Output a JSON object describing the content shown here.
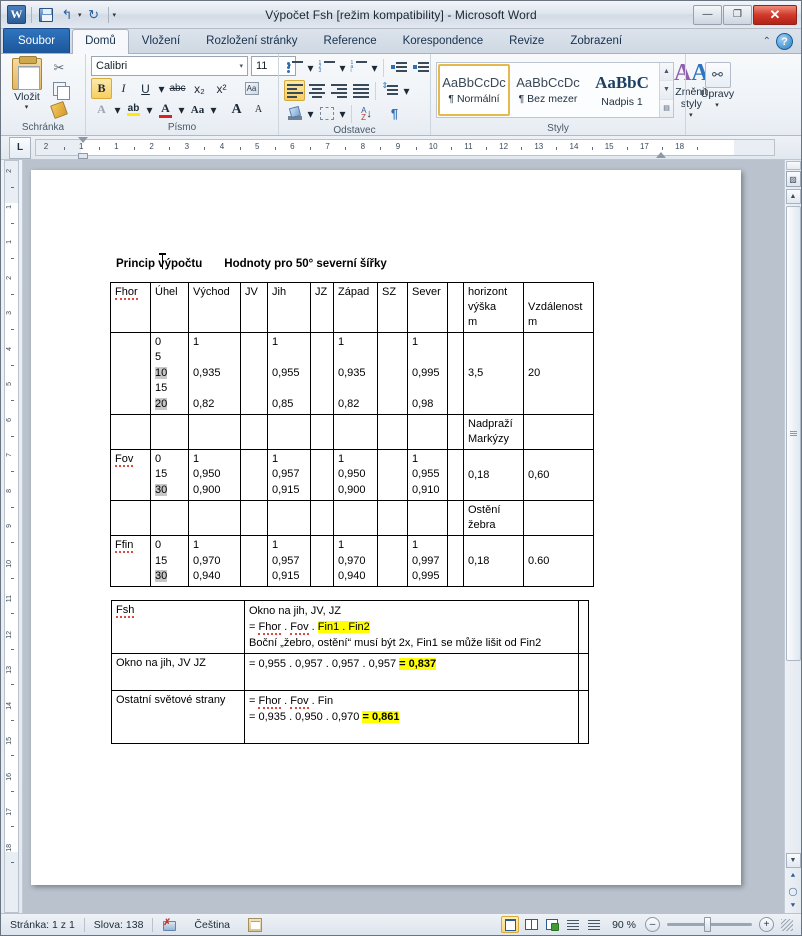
{
  "window": {
    "title": "Výpočet Fsh [režim kompatibility]  -  Microsoft Word",
    "logo": "W",
    "minimize": "—",
    "maximize": "❐",
    "close": "✕"
  },
  "quick_access": {
    "save": "save-icon",
    "undo": "↰",
    "undo_caret": "▾",
    "redo": "↻",
    "customize": "▾"
  },
  "tabs": [
    {
      "label": "Soubor",
      "type": "file"
    },
    {
      "label": "Domů",
      "type": "active"
    },
    {
      "label": "Vložení",
      "type": "normal"
    },
    {
      "label": "Rozložení stránky",
      "type": "normal"
    },
    {
      "label": "Reference",
      "type": "normal"
    },
    {
      "label": "Korespondence",
      "type": "normal"
    },
    {
      "label": "Revize",
      "type": "normal"
    },
    {
      "label": "Zobrazení",
      "type": "normal"
    }
  ],
  "tab_right": {
    "minimize_ribbon": "⌃",
    "help": "?"
  },
  "ribbon": {
    "clipboard": {
      "label": "Schránka",
      "paste": "Vložit",
      "paste_caret": "▾",
      "cut": "✂",
      "copy": "copy-icon",
      "format_painter": "format-painter-icon",
      "launcher": "⌜"
    },
    "font": {
      "label": "Písmo",
      "font_name": "Calibri",
      "font_size": "11",
      "grow": "A",
      "shrink": "A",
      "clear_format": "Aa",
      "bold": "B",
      "italic": "I",
      "underline": "U",
      "strikethrough": "abc",
      "subscript": "x₂",
      "superscript": "x²",
      "change_case": "Aa",
      "text_highlight": "ab",
      "font_color": "A",
      "text_effects": "A",
      "caret": "▾",
      "launcher": "⌜"
    },
    "paragraph": {
      "label": "Odstavec",
      "bullets": "bullets-icon",
      "numbering": "numbering-icon",
      "multilevel": "multilevel-list-icon",
      "decrease_indent": "decrease-indent-icon",
      "increase_indent": "increase-indent-icon",
      "align_left": "align-left-icon",
      "align_center": "align-center-icon",
      "align_right": "align-right-icon",
      "justify": "justify-icon",
      "line_spacing": "line-spacing-icon",
      "shading": "shading-icon",
      "borders": "borders-icon",
      "sort_a": "A",
      "sort_z": "Z",
      "sort_arrow": "↓",
      "show_marks": "¶",
      "caret": "▾",
      "launcher": "⌜"
    },
    "styles": {
      "label": "Styly",
      "items": [
        {
          "preview": "AaBbCcDc",
          "name": "¶ Normální",
          "selected": true
        },
        {
          "preview": "AaBbCcDc",
          "name": "¶ Bez mezer",
          "selected": false
        },
        {
          "preview": "AaBbC",
          "name": "Nadpis 1",
          "selected": false
        }
      ],
      "scroll_up": "▲",
      "scroll_down": "▼",
      "more": "▤",
      "change_styles": "Změnit styly",
      "change_styles_caret": "▾",
      "launcher": "⌜"
    },
    "editing": {
      "label": "Úpravy",
      "button": "Úpravy",
      "icon": "binoculars-icon",
      "caret": "▾"
    }
  },
  "ruler": {
    "tab_selector": "L",
    "h_labels": [
      "2",
      "1",
      "1",
      "2",
      "3",
      "4",
      "5",
      "6",
      "7",
      "8",
      "9",
      "10",
      "11",
      "12",
      "13",
      "14",
      "15",
      "17",
      "18"
    ],
    "v_labels": [
      "2",
      "1",
      "1",
      "2",
      "3",
      "4",
      "5",
      "6",
      "7",
      "8",
      "9",
      "10",
      "11",
      "12",
      "13",
      "14",
      "15",
      "16",
      "17",
      "18"
    ]
  },
  "document": {
    "heading_1": "Princip výpočtu",
    "heading_2": "Hodnoty pro 50° severní šířky",
    "table1": {
      "headers": [
        "Fhor",
        "Úhel",
        "Východ",
        "JV",
        "Jih",
        "JZ",
        "Západ",
        "SZ",
        "Sever",
        "",
        "horizont výška m",
        "Vzdálenost m"
      ],
      "header_spell": [
        "Fhor"
      ],
      "rows": [
        {
          "label": "",
          "angles": [
            "0",
            "5",
            "10",
            "15",
            "20"
          ],
          "angles_hl": [
            false,
            false,
            true,
            false,
            true
          ],
          "vychod": [
            "1",
            "",
            "0,935",
            "",
            "0,82"
          ],
          "jv": [
            "",
            "",
            "",
            "",
            ""
          ],
          "jih": [
            "1",
            "",
            "0,955",
            "",
            "0,85"
          ],
          "jz": [
            "",
            "",
            "",
            "",
            ""
          ],
          "zapad": [
            "1",
            "",
            "0,935",
            "",
            "0,82"
          ],
          "sz": [
            "",
            "",
            "",
            "",
            ""
          ],
          "sever": [
            "1",
            "",
            "0,995",
            "",
            "0,98"
          ],
          "blank": "",
          "horizont": "3,5",
          "vzdalenost": "20"
        },
        {
          "label": "",
          "angles": [],
          "vychod": [],
          "jv": [],
          "jih": [],
          "jz": [],
          "zapad": [],
          "sz": [],
          "sever": [],
          "blank": "",
          "horizont": "Nadpraží\nMarkýzy",
          "horizont_lines": [
            "Nadpraží",
            "Markýzy"
          ],
          "vzdalenost": ""
        },
        {
          "label": "Fov",
          "label_spell": true,
          "angles": [
            "0",
            "15",
            "30"
          ],
          "angles_hl": [
            false,
            false,
            true
          ],
          "vychod": [
            "1",
            "0,950",
            "0,900"
          ],
          "jv": [
            "",
            "",
            ""
          ],
          "jih": [
            "1",
            "0,957",
            "0,915"
          ],
          "jz": [
            "",
            "",
            ""
          ],
          "zapad": [
            "1",
            "0,950",
            "0,900"
          ],
          "sz": [
            "",
            "",
            ""
          ],
          "sever": [
            "1",
            "0,955",
            "0,910"
          ],
          "blank": "",
          "horizont": "0,18",
          "vzdalenost": "0,60"
        },
        {
          "label": "",
          "angles": [],
          "vychod": [],
          "jv": [],
          "jih": [],
          "jz": [],
          "zapad": [],
          "sz": [],
          "sever": [],
          "blank": "",
          "horizont_lines": [
            "Ostění",
            "žebra"
          ],
          "vzdalenost": ""
        },
        {
          "label": "Ffin",
          "label_spell": true,
          "angles": [
            "0",
            "15",
            "30"
          ],
          "angles_hl": [
            false,
            false,
            true
          ],
          "vychod": [
            "1",
            "0,970",
            "0,940"
          ],
          "jv": [
            "",
            "",
            ""
          ],
          "jih": [
            "1",
            "0,957",
            "0,915"
          ],
          "jz": [
            "",
            "",
            ""
          ],
          "zapad": [
            "1",
            "0,970",
            "0,940"
          ],
          "sz": [
            "",
            "",
            ""
          ],
          "sever": [
            "1",
            "0,997",
            "0,995"
          ],
          "blank": "",
          "horizont": "0,18",
          "vzdalenost": "0.60"
        }
      ]
    },
    "table2": {
      "rows": [
        {
          "label": "Fsh",
          "label_spell": true,
          "lines": [
            {
              "text": "Okno na jih, JV, JZ"
            },
            {
              "prefix": "= ",
              "sp1": "Fhor",
              "mid": " . ",
              "sp2": "Fov",
              "mid2": " . ",
              "hl": "Fin1 . Fin2"
            },
            {
              "text": "Boční „žebro, ostění“ musí být 2x, Fin1 se může lišit od Fin2"
            }
          ],
          "third": ""
        },
        {
          "label": "Okno na jih, JV JZ",
          "label_spell": false,
          "lines": [
            {
              "plain": "= 0,955 . 0,957 . 0,957 . 0,957 ",
              "hl": "=  0,837"
            }
          ],
          "third": ""
        },
        {
          "label": "Ostatní světové strany",
          "label_spell": false,
          "lines": [
            {
              "prefix": " = ",
              "sp1": "Fhor",
              "mid": " . ",
              "sp2": "Fov",
              "mid2": " . Fin"
            },
            {
              "plain": "= 0,935 . 0,950 . 0,970      ",
              "hl": "=  0,861"
            }
          ],
          "third": ""
        }
      ]
    }
  },
  "status_bar": {
    "page": "Stránka: 1 z 1",
    "words": "Slova: 138",
    "proofing_icon": "proofing-errors-icon",
    "language": "Čeština",
    "macro_icon": "macro-record-icon",
    "views": [
      {
        "name": "print-layout-view",
        "selected": true
      },
      {
        "name": "full-screen-reading-view",
        "selected": false
      },
      {
        "name": "web-layout-view",
        "selected": false
      },
      {
        "name": "outline-view",
        "selected": false
      },
      {
        "name": "draft-view",
        "selected": false
      }
    ],
    "zoom": "90 %",
    "zoom_out": "–",
    "zoom_in": "+"
  },
  "colors": {
    "accent": "#2f74c0",
    "highlight_yellow": "#ffff00",
    "highlight_gray": "#c7c7c7",
    "spell_error": "#e04a3c",
    "close_red": "#cf3a2c"
  }
}
